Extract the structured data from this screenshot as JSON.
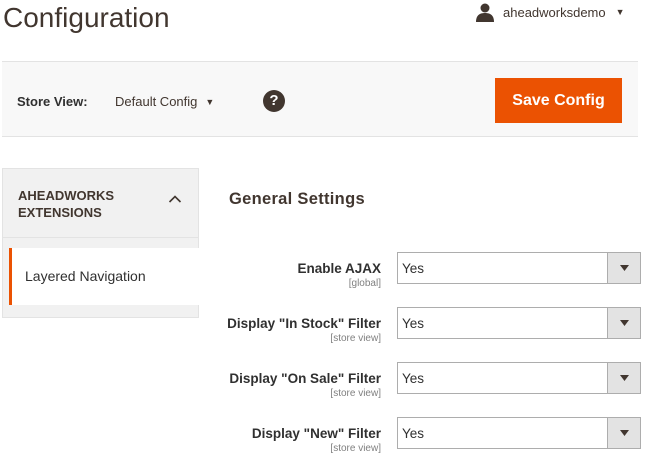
{
  "header": {
    "title": "Configuration",
    "user": {
      "name": "aheadworksdemo",
      "icon": "user-icon"
    }
  },
  "store_bar": {
    "label": "Store View:",
    "selected": "Default Config",
    "help_icon": "question-circle-icon",
    "help_glyph": "?",
    "save_label": "Save Config"
  },
  "sidebar": {
    "group_title": "AHEADWORKS EXTENSIONS",
    "group_icon": "chevron-up-icon",
    "items": [
      {
        "label": "Layered Navigation",
        "active": true
      }
    ]
  },
  "section": {
    "title": "General Settings",
    "fields": [
      {
        "label": "Enable AJAX",
        "scope": "[global]",
        "value": "Yes"
      },
      {
        "label": "Display \"In Stock\" Filter",
        "scope": "[store view]",
        "value": "Yes"
      },
      {
        "label": "Display \"On Sale\" Filter",
        "scope": "[store view]",
        "value": "Yes"
      },
      {
        "label": "Display \"New\" Filter",
        "scope": "[store view]",
        "value": "Yes"
      }
    ]
  },
  "colors": {
    "accent": "#eb5202",
    "text_dark": "#41362f",
    "bar_bg": "#f8f8f8"
  }
}
